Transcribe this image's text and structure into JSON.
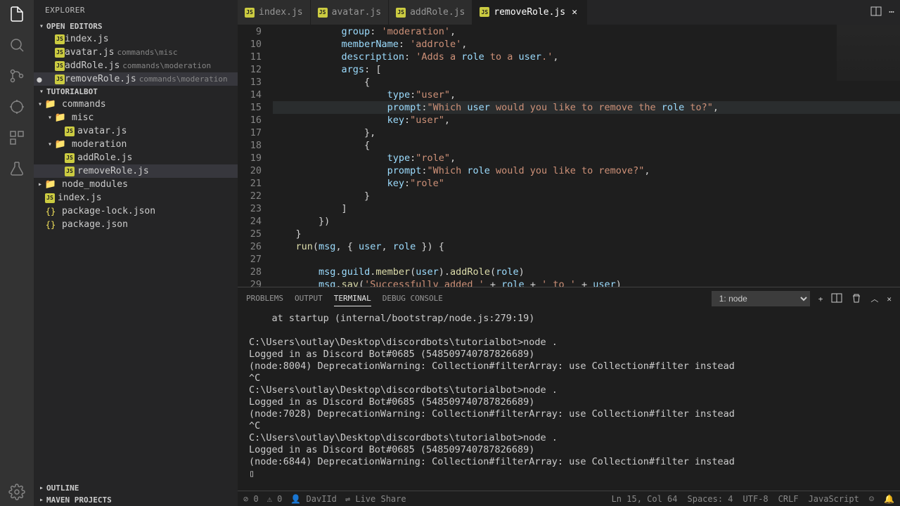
{
  "sidebar": {
    "title": "EXPLORER",
    "openEditors": {
      "label": "OPEN EDITORS",
      "items": [
        {
          "name": "index.js",
          "path": "",
          "dirty": false,
          "active": false
        },
        {
          "name": "avatar.js",
          "path": "commands\\misc",
          "dirty": false,
          "active": false
        },
        {
          "name": "addRole.js",
          "path": "commands\\moderation",
          "dirty": false,
          "active": false
        },
        {
          "name": "removeRole.js",
          "path": "commands\\moderation",
          "dirty": true,
          "active": true
        }
      ]
    },
    "workspace": {
      "label": "TUTORIALBOT",
      "tree": [
        {
          "type": "folder",
          "name": "commands",
          "depth": 0,
          "expanded": true
        },
        {
          "type": "folder",
          "name": "misc",
          "depth": 1,
          "expanded": true
        },
        {
          "type": "file",
          "name": "avatar.js",
          "depth": 2
        },
        {
          "type": "folder",
          "name": "moderation",
          "depth": 1,
          "expanded": true
        },
        {
          "type": "file",
          "name": "addRole.js",
          "depth": 2
        },
        {
          "type": "file",
          "name": "removeRole.js",
          "depth": 2,
          "selected": true
        },
        {
          "type": "folder",
          "name": "node_modules",
          "depth": 0,
          "expanded": false
        },
        {
          "type": "file",
          "name": "index.js",
          "depth": 0
        },
        {
          "type": "file",
          "name": "package-lock.json",
          "depth": 0
        },
        {
          "type": "file",
          "name": "package.json",
          "depth": 0
        }
      ]
    },
    "outline": "OUTLINE",
    "maven": "MAVEN PROJECTS"
  },
  "tabs": [
    {
      "name": "index.js",
      "active": false
    },
    {
      "name": "avatar.js",
      "active": false
    },
    {
      "name": "addRole.js",
      "active": false
    },
    {
      "name": "removeRole.js",
      "active": true
    }
  ],
  "editor": {
    "startLine": 9,
    "lines": [
      "            group: 'moderation',",
      "            memberName: 'addrole',",
      "            description: 'Adds a role to a user.',",
      "            args: [",
      "                {",
      "                    type:\"user\",",
      "                    prompt:\"Which user would you like to remove the role to?\",",
      "                    key:\"user\",",
      "                },",
      "                {",
      "                    type:\"role\",",
      "                    prompt:\"Which role would you like to remove?\",",
      "                    key:\"role\"",
      "                }",
      "            ]",
      "        })",
      "    }",
      "    run(msg, { user, role }) {",
      "",
      "        msg.guild.member(user).addRole(role)",
      "        msg.sav('Successfullv added ' + role + ' to ' + user)"
    ],
    "highlightLine": 15
  },
  "panel": {
    "tabs": [
      "PROBLEMS",
      "OUTPUT",
      "TERMINAL",
      "DEBUG CONSOLE"
    ],
    "activeTab": "TERMINAL",
    "selectLabel": "1: node",
    "terminal": "    at startup (internal/bootstrap/node.js:279:19)\n\nC:\\Users\\outlay\\Desktop\\discordbots\\tutorialbot>node .\nLogged in as Discord Bot#0685 (548509740787826689)\n(node:8004) DeprecationWarning: Collection#filterArray: use Collection#filter instead\n^C\nC:\\Users\\outlay\\Desktop\\discordbots\\tutorialbot>node .\nLogged in as Discord Bot#0685 (548509740787826689)\n(node:7028) DeprecationWarning: Collection#filterArray: use Collection#filter instead\n^C\nC:\\Users\\outlay\\Desktop\\discordbots\\tutorialbot>node .\nLogged in as Discord Bot#0685 (548509740787826689)\n(node:6844) DeprecationWarning: Collection#filterArray: use Collection#filter instead\n▯"
  },
  "statusBar": {
    "errors": "0",
    "warnings": "0",
    "user": "DavIId",
    "liveShare": "Live Share",
    "position": "Ln 15, Col 64",
    "spaces": "Spaces: 4",
    "encoding": "UTF-8",
    "eol": "CRLF",
    "language": "JavaScript",
    "feedback": "☺"
  }
}
